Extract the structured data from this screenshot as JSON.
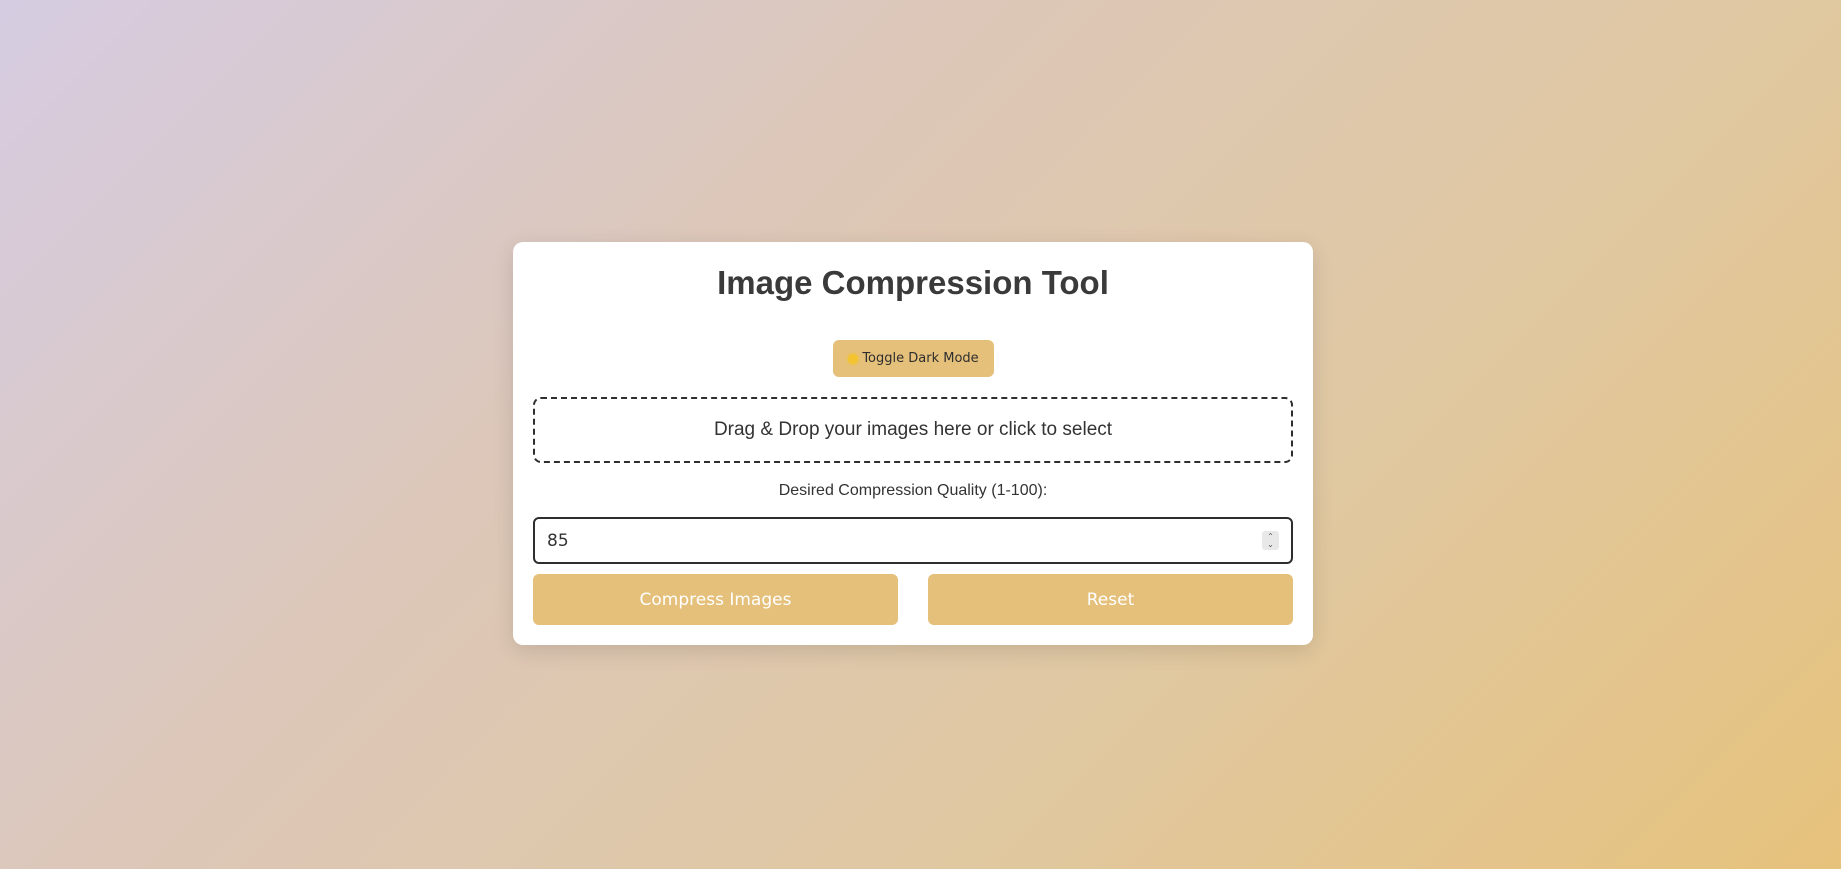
{
  "page": {
    "title": "Image Compression Tool"
  },
  "toolbar": {
    "toggle_icon": "sun-icon",
    "toggle_label": "Toggle Dark Mode"
  },
  "dropzone": {
    "text": "Drag & Drop your images here or click to select"
  },
  "quality": {
    "label": "Desired Compression Quality (1-100):",
    "value": "85"
  },
  "actions": {
    "compress_label": "Compress Images",
    "reset_label": "Reset"
  },
  "colors": {
    "accent": "#e5c07a",
    "text": "#3a3a3a",
    "card_bg": "#ffffff"
  }
}
